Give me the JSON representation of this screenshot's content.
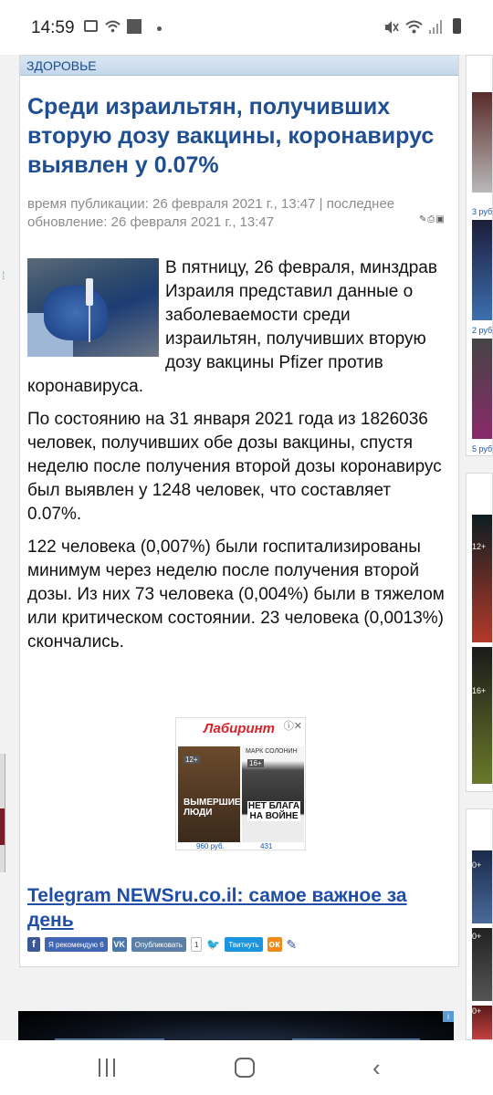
{
  "status_bar": {
    "time": "14:59"
  },
  "article": {
    "section": "ЗДОРОВЬЕ",
    "headline": "Среди израильтян, получивших вторую дозу вакцины, коронавирус выявлен у 0.07%",
    "meta": "время публикации: 26 февраля 2021 г., 13:47 | последнее обновление: 26 февраля 2021 г., 13:47",
    "paragraphs": [
      "В пятницу, 26 февраля, минздрав Израиля представил данные о заболеваемости среди израильтян, получивших вторую дозу вакцины Pfizer против коронавируса.",
      "По состоянию на 31 января 2021 года из  1826036 человек, получивших обе дозы вакцины, спустя неделю после получения второй дозы коронавирус был выявлен у 1248 человек, что составляет 0.07%.",
      "122 человека (0,007%) были госпитализированы минимум через неделю после получения второй дозы. Из них 73 человека (0,004%) были в тяжелом или критическом состоянии. 23 человека (0,0013%) скончались."
    ],
    "telegram_link": "Telegram NEWSru.co.il: самое важное за день"
  },
  "ad": {
    "brand": "Лабиринт",
    "book1": {
      "age": "12+",
      "title": "ВЫМЕРШИЕ ЛЮДИ",
      "price": "960 руб."
    },
    "book2": {
      "age": "16+",
      "author": "МАРК СОЛОНИН",
      "title": "НЕТ БЛАГА НА ВОЙНЕ",
      "price": "431"
    }
  },
  "share": {
    "fb_icon": "f",
    "recommend": "Я рекомендую 6",
    "vk_icon": "VK",
    "vk_publish": "Опубликовать",
    "vk_count": "1",
    "tweet": "Твитнуть",
    "ok_icon": "ок"
  },
  "right_column": {
    "prices": [
      "3 руб",
      "2 руб",
      "5 руб"
    ],
    "ages": [
      "12+",
      "16+",
      "0+",
      "0+",
      "0+"
    ]
  }
}
